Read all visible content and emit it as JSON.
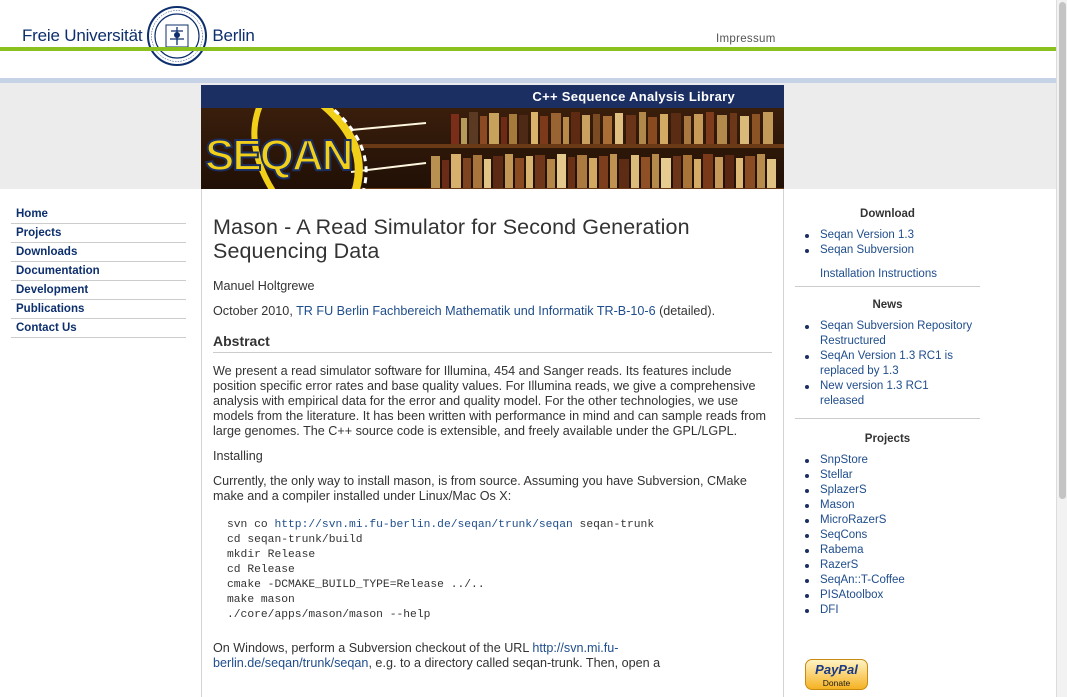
{
  "header": {
    "logo_left": "Freie Universität",
    "logo_right": "Berlin",
    "impressum": "Impressum"
  },
  "banner": {
    "title": "C++ Sequence Analysis Library",
    "logo_text": "SEQAN"
  },
  "leftnav": {
    "items": [
      {
        "label": "Home"
      },
      {
        "label": "Projects"
      },
      {
        "label": "Downloads"
      },
      {
        "label": "Documentation"
      },
      {
        "label": "Development"
      },
      {
        "label": "Publications"
      },
      {
        "label": "Contact Us"
      }
    ]
  },
  "main": {
    "title": "Mason - A Read Simulator for Second Generation Sequencing Data",
    "author": "Manuel Holtgrewe",
    "date": "October 2010, ",
    "report_link": "TR FU Berlin Fachbereich Mathematik und Informatik TR-B-10-6",
    "detailed": " (detailed).",
    "abstract_heading": "Abstract",
    "abstract": "We present a read simulator software for Illumina, 454 and Sanger reads. Its features include position specific error rates and base quality values. For Illumina reads, we give a comprehensive analysis with empirical data for the error and quality model. For the other technologies, we use models from the literature. It has been written with performance in mind and can sample reads from large genomes. The C++ source code is extensible, and freely available under the GPL/LGPL.",
    "installing": "Installing",
    "install_text": "Currently, the only way to install mason, is from source. Assuming you have Subversion, CMake make and a compiler installed under Linux/Mac Os X:",
    "code": {
      "line1_prefix": "svn co ",
      "line1_link": "http://svn.mi.fu-berlin.de/seqan/trunk/seqan",
      "line1_suffix": " seqan-trunk",
      "line2": "cd seqan-trunk/build",
      "line3": "mkdir Release",
      "line4": "cd Release",
      "line5": "cmake -DCMAKE_BUILD_TYPE=Release ../..",
      "line6": "make mason",
      "line7": "./core/apps/mason/mason --help"
    },
    "windows_prefix": "On Windows, perform a Subversion checkout of the URL ",
    "windows_link": "http://svn.mi.fu-berlin.de/seqan/trunk/seqan",
    "windows_suffix": ", e.g. to a directory called seqan-trunk. Then, open a"
  },
  "sidebar": {
    "download_heading": "Download",
    "download_items": [
      {
        "label": "Seqan Version 1.3"
      },
      {
        "label": "Seqan Subversion"
      }
    ],
    "install_instructions": "Installation Instructions",
    "news_heading": "News",
    "news_items": [
      {
        "label": "Seqan Subversion Repository Restructured"
      },
      {
        "label": "SeqAn Version 1.3 RC1 is replaced by 1.3"
      },
      {
        "label": "New version 1.3 RC1 released"
      }
    ],
    "projects_heading": "Projects",
    "project_items": [
      {
        "label": "SnpStore"
      },
      {
        "label": "Stellar"
      },
      {
        "label": "SplazerS"
      },
      {
        "label": "Mason"
      },
      {
        "label": "MicroRazerS"
      },
      {
        "label": "SeqCons"
      },
      {
        "label": "Rabema"
      },
      {
        "label": "RazerS"
      },
      {
        "label": "SeqAn::T-Coffee"
      },
      {
        "label": "PISAtoolbox"
      },
      {
        "label": "DFI"
      }
    ],
    "paypal_label": "PayPal",
    "donate_label": "Donate"
  }
}
